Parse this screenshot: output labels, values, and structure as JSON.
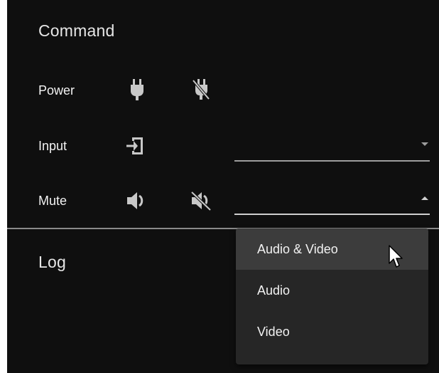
{
  "command": {
    "title": "Command",
    "power": {
      "label": "Power",
      "on_icon": "plug-icon",
      "off_icon": "plug-off-icon"
    },
    "input": {
      "label": "Input",
      "icon": "input-icon",
      "selected_value": ""
    },
    "mute": {
      "label": "Mute",
      "on_icon": "volume-icon",
      "off_icon": "volume-off-icon",
      "selected_value": "",
      "dropdown_open": true
    }
  },
  "log": {
    "title": "Log"
  },
  "mute_menu": {
    "options": [
      "Audio & Video",
      "Audio",
      "Video"
    ],
    "hovered": "Audio & Video"
  },
  "colors": {
    "background": "#0f0f0f",
    "menu_background": "#262626",
    "menu_hover": "#3c3c3c",
    "text": "#f2f2f2",
    "icon": "#c8c8c8"
  }
}
